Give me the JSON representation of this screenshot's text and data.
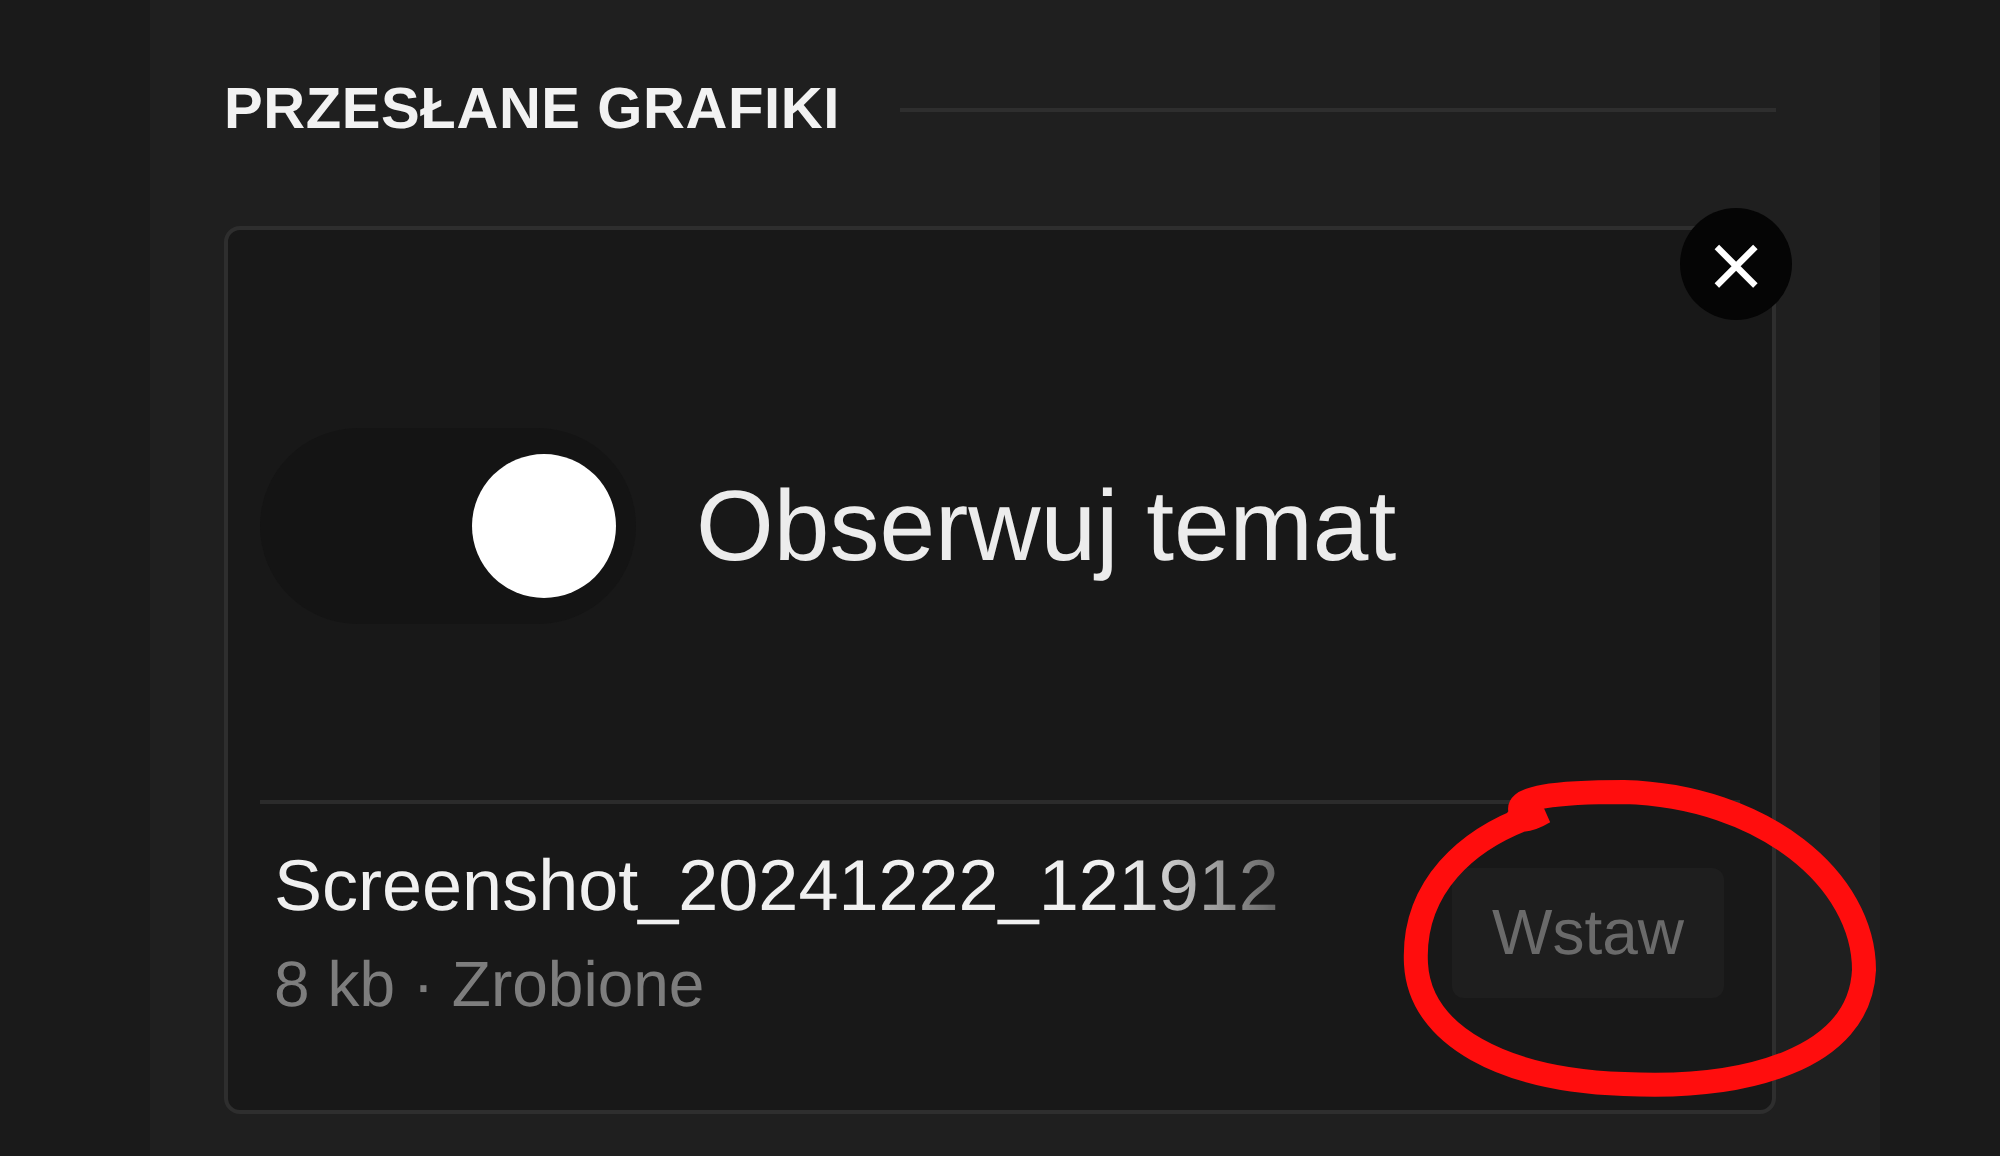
{
  "section": {
    "title": "PRZESŁANE GRAFIKI"
  },
  "upload": {
    "preview": {
      "toggle": {
        "on": true
      },
      "label": "Obserwuj temat"
    },
    "file_name": "Screenshot_20241222_121912",
    "meta": "8 kb · Zrobione",
    "insert_button": {
      "label": "Wstaw",
      "disabled": true
    },
    "remove_button": {
      "label": "×"
    }
  },
  "annotation": {
    "kind": "circle",
    "color": "#ff0d0d"
  }
}
